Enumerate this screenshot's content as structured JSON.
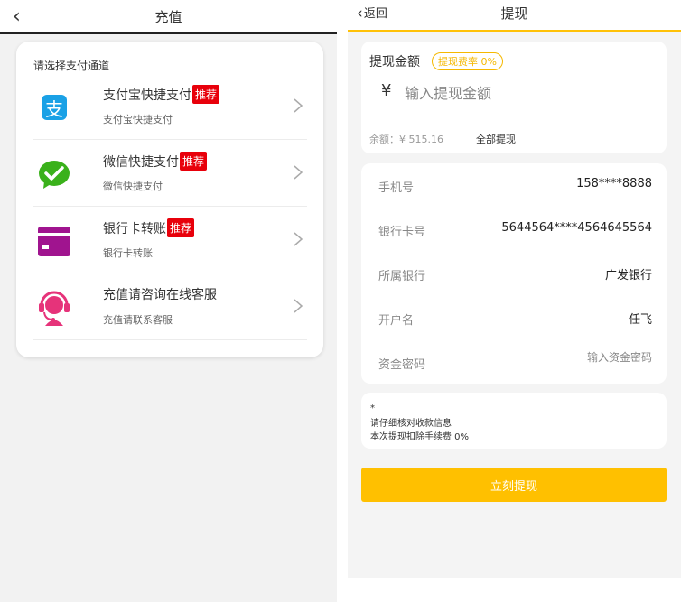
{
  "left": {
    "header": {
      "title": "充值",
      "back_icon": "chevron-left-icon"
    },
    "card_title": "请选择支付通道",
    "items": [
      {
        "name": "支付宝快捷支付",
        "badge": "推荐",
        "desc": "支付宝快捷支付",
        "icon": "alipay-icon",
        "color": "#1aa1e6"
      },
      {
        "name": "微信快捷支付",
        "badge": "推荐",
        "desc": "微信快捷支付",
        "icon": "wechat-pay-icon",
        "color": "#3ab11b"
      },
      {
        "name": "银行卡转账",
        "badge": "推荐",
        "desc": "银行卡转账",
        "icon": "bank-card-icon",
        "color": "#a0148f"
      },
      {
        "name": "充值请咨询在线客服",
        "badge": "",
        "desc": "充值请联系客服",
        "icon": "customer-service-icon",
        "color": "#e6337a"
      }
    ],
    "badge_color": "#e8000b"
  },
  "right": {
    "header": {
      "back_label": "返回",
      "title": "提现",
      "accent": "#ffc107"
    },
    "amount": {
      "label": "提现金额",
      "fee_label": "提现费率 0%",
      "currency": "¥",
      "placeholder": "输入提现金额",
      "balance": "余额：¥ 515.16",
      "withdraw_all": "全部提现"
    },
    "info": {
      "phone_label": "手机号",
      "phone_value": "158****8888",
      "card_label": "银行卡号",
      "card_value": "5644564****4564645564",
      "bank_label": "所属银行",
      "bank_value": "广发银行",
      "holder_label": "开户名",
      "holder_value": "任飞",
      "pwd_label": "资金密码",
      "pwd_placeholder": "输入资金密码"
    },
    "notes": {
      "line1": "*",
      "line2": "请仔细核对收款信息",
      "line3": "本次提现扣除手续费 0%"
    },
    "submit_label": "立刻提现",
    "submit_color": "#ffc000"
  }
}
